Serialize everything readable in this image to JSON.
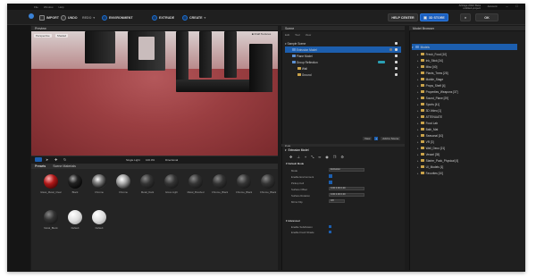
{
  "menubar": [
    "File",
    "Window",
    "Help"
  ],
  "window_title": {
    "line1": "Artrage 2022 Beta",
    "line2": "untitled-project"
  },
  "account": "Account",
  "toolbar": {
    "import": "IMPORT",
    "undo": "UNDO",
    "redo": "REDO",
    "environment": "ENVIRONMENT",
    "extrude": "EXTRUDE",
    "create": "CREATE",
    "help_center": "HELP CENTER",
    "store": "3D STORE",
    "ok": "OK"
  },
  "viewport": {
    "header": "Preview",
    "perspective": "Perspective",
    "shaded": "Shaded",
    "draft": "Draft Textures",
    "single_light": "Single Light",
    "zoom": "100.0%",
    "directional": "Directional"
  },
  "presets": {
    "tabs": [
      "Presets",
      "Scene Materials"
    ],
    "items": [
      {
        "label": "Glass_Metal_Clear",
        "style": "red"
      },
      {
        "label": "Black",
        "style": "black"
      },
      {
        "label": "Chrome",
        "style": "chrome"
      },
      {
        "label": "Chrome",
        "style": "chrome2"
      },
      {
        "label": "Metal_Dark",
        "style": "dark"
      },
      {
        "label": "Gloss Light",
        "style": "dark"
      },
      {
        "label": "Metal_Brushed",
        "style": "dark"
      },
      {
        "label": "Chrome_Black",
        "style": "dark"
      },
      {
        "label": "Chrome_Black",
        "style": "dark"
      },
      {
        "label": "Chrome_Black",
        "style": "dark"
      },
      {
        "label": "Metal_Blank",
        "style": "dark"
      },
      {
        "label": "Default",
        "style": "white"
      },
      {
        "label": "Default",
        "style": "white"
      }
    ]
  },
  "scene": {
    "header": "Scene",
    "tabs": [
      "Edit",
      "Tool",
      "View"
    ],
    "rows": [
      "Sample Scene",
      "Extrusion Model",
      "Plane Model",
      "Group Reflection",
      "Wall",
      "Ground"
    ],
    "view": "View",
    "add_scene": "Add to Scene"
  },
  "edit": {
    "header": "Edit",
    "object": "Extrusion Model",
    "section1": "Default Mode",
    "fields": [
      {
        "label": "Mode",
        "value": "Extrusion"
      },
      {
        "label": "Enable Environment",
        "value": ""
      },
      {
        "label": "Pickup Cell",
        "value": ""
      },
      {
        "label": "Surface Offset",
        "value": "0.00   0.00   0.00"
      },
      {
        "label": "Surface Rotation",
        "value": "0.00   0.00   0.00"
      },
      {
        "label": "Mirror Flip",
        "value": "Off"
      }
    ],
    "section2": "Advanced",
    "adv": [
      "Enable Subdivision",
      "Enable Fresh Shade"
    ]
  },
  "browser": {
    "header": "Model Browser",
    "top": "Models",
    "items": [
      "Fresh_Food [10]",
      "Ink_Stick [34]",
      "Misc [40]",
      "Plants_Trees [28]",
      "Mobile_Stage",
      "Props_Shelf [4]",
      "Properties_Weapons [37]",
      "Sound_Plane [29]",
      "Sports [41]",
      "3D Video [1]",
      "ATTENUATE",
      "Food Lab",
      "Bath_Mat",
      "Seasonal [10]",
      "VR [3]",
      "Wall_Deco [21]",
      "Vessel [35]",
      "Starter_Pack_Physical [4]",
      "UI_Models [1]",
      "Favorites [10]"
    ]
  },
  "colors": {
    "accent": "#1c5eae",
    "floor": "#9a3e41",
    "panel": "#1f1f1f"
  }
}
